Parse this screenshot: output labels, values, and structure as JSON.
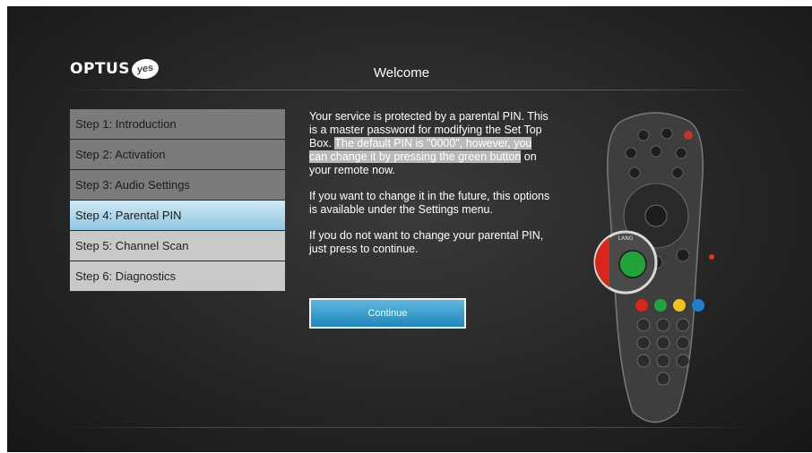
{
  "brand": {
    "name": "OPTUS",
    "badge": "yes"
  },
  "header": {
    "title": "Welcome"
  },
  "steps": [
    {
      "label": "Step 1: Introduction",
      "state": "done"
    },
    {
      "label": "Step 2: Activation",
      "state": "done"
    },
    {
      "label": "Step 3: Audio Settings",
      "state": "done"
    },
    {
      "label": "Step 4: Parental PIN",
      "state": "active"
    },
    {
      "label": "Step 5: Channel Scan",
      "state": "todo"
    },
    {
      "label": "Step 6: Diagnostics",
      "state": "todo"
    }
  ],
  "content": {
    "p1_a": "Your service is protected by a parental PIN. This is a master password for modifying the Set Top Box. ",
    "p1_highlight": "The default PIN is \"0000\", however, you can change it by pressing the green button",
    "p1_b": " on your remote now.",
    "p2": "If you want to change it in the future, this options is available under the Settings menu.",
    "p3": "If you do not want to change your parental PIN, just press to continue."
  },
  "buttons": {
    "continue_label": "Continue"
  },
  "remote": {
    "lang_label": "LANG"
  },
  "colors": {
    "background": "#262626",
    "active_step": "#8ec7e2",
    "button": "#1f86bd",
    "remote_red": "#d9261c",
    "remote_green": "#21a33a",
    "remote_yellow": "#f0c419",
    "remote_blue": "#1e7fd0"
  }
}
